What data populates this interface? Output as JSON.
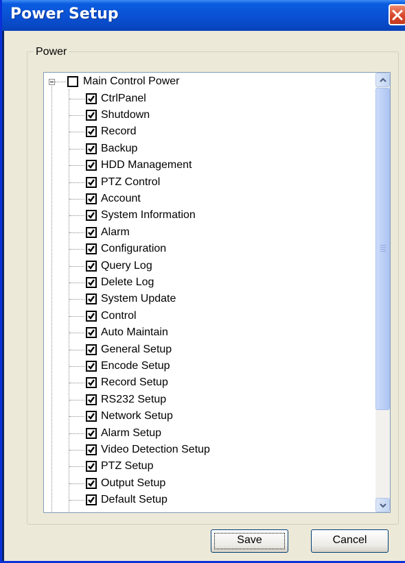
{
  "window": {
    "title": "Power Setup",
    "close_icon": "close-icon"
  },
  "group": {
    "label": "Power"
  },
  "tree": {
    "root": {
      "label": "Main Control Power",
      "checked": false,
      "expanded": true
    },
    "children": [
      {
        "label": "CtrlPanel",
        "checked": true
      },
      {
        "label": "Shutdown",
        "checked": true
      },
      {
        "label": "Record",
        "checked": true
      },
      {
        "label": "Backup",
        "checked": true
      },
      {
        "label": "HDD Management",
        "checked": true
      },
      {
        "label": "PTZ Control",
        "checked": true
      },
      {
        "label": "Account",
        "checked": true
      },
      {
        "label": "System Information",
        "checked": true
      },
      {
        "label": "Alarm",
        "checked": true
      },
      {
        "label": "Configuration",
        "checked": true
      },
      {
        "label": "Query Log",
        "checked": true
      },
      {
        "label": "Delete Log",
        "checked": true
      },
      {
        "label": "System Update",
        "checked": true
      },
      {
        "label": "Control",
        "checked": true
      },
      {
        "label": "Auto Maintain",
        "checked": true
      },
      {
        "label": "General Setup",
        "checked": true
      },
      {
        "label": "Encode Setup",
        "checked": true
      },
      {
        "label": "Record Setup",
        "checked": true
      },
      {
        "label": "RS232 Setup",
        "checked": true
      },
      {
        "label": "Network Setup",
        "checked": true
      },
      {
        "label": "Alarm Setup",
        "checked": true
      },
      {
        "label": "Video Detection Setup",
        "checked": true
      },
      {
        "label": "PTZ Setup",
        "checked": true
      },
      {
        "label": "Output Setup",
        "checked": true
      },
      {
        "label": "Default Setup",
        "checked": true
      }
    ]
  },
  "buttons": {
    "save": "Save",
    "cancel": "Cancel"
  }
}
